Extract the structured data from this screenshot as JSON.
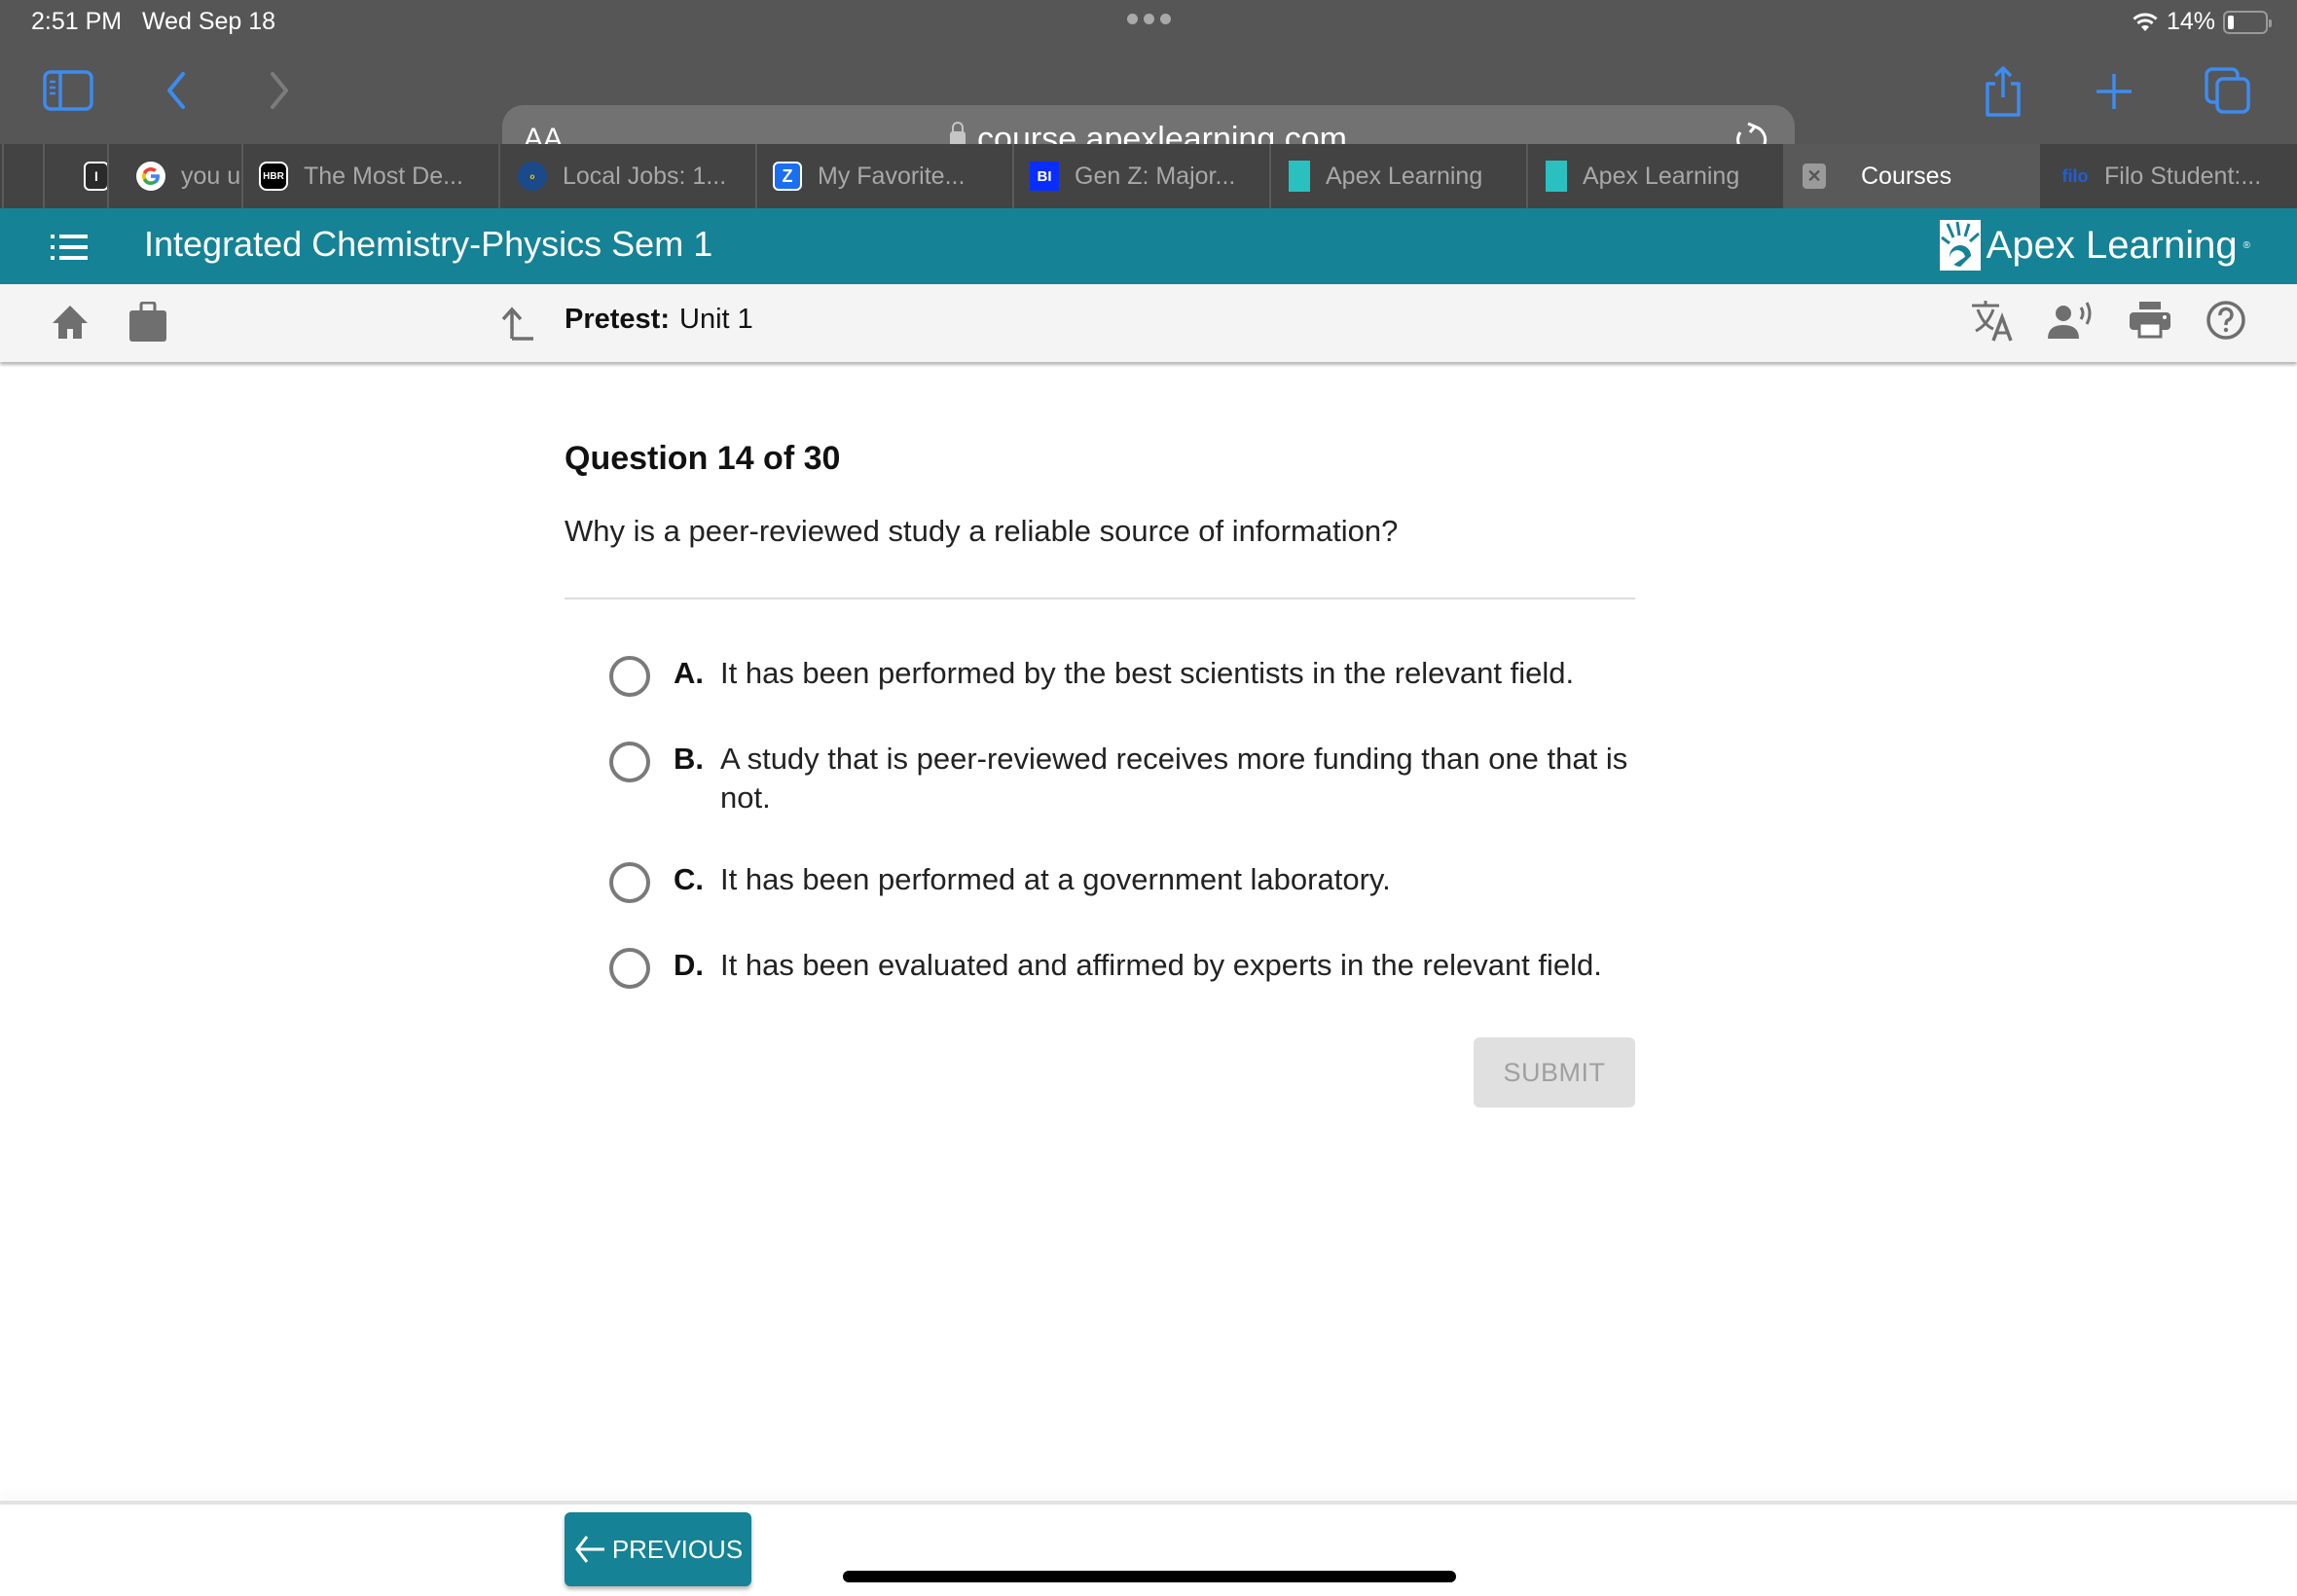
{
  "status_bar": {
    "time": "2:51 PM",
    "date": "Wed Sep 18",
    "battery_percent": "14%",
    "battery_level": 0.14
  },
  "browser": {
    "address_aa": "AA",
    "url": "course.apexlearning.com",
    "tabs": [
      {
        "title": "",
        "favicon": "I"
      },
      {
        "title": "you u",
        "favicon": "google-icon"
      },
      {
        "title": "The Most De...",
        "favicon": "HBR"
      },
      {
        "title": "Local Jobs: 1...",
        "favicon": "onet-icon"
      },
      {
        "title": "My Favorite...",
        "favicon": "zillow-icon"
      },
      {
        "title": "Gen Z: Major...",
        "favicon": "BI"
      },
      {
        "title": "Apex Learning",
        "favicon": "apex-icon"
      },
      {
        "title": "Apex Learning",
        "favicon": "apex-icon"
      },
      {
        "title": "Courses",
        "favicon": "close-icon",
        "active": true
      },
      {
        "title": "Filo Student:...",
        "favicon": "filo"
      }
    ]
  },
  "apex": {
    "course_title": "Integrated Chemistry-Physics Sem 1",
    "logo_text": "Apex Learning",
    "logo_reg": "®",
    "breadcrumb_label": "Pretest:",
    "breadcrumb_value": "Unit 1"
  },
  "question": {
    "number_label": "Question 14 of 30",
    "prompt": "Why is a peer-reviewed study a reliable source of information?",
    "options": [
      {
        "letter": "A.",
        "text": "It has been performed by the best scientists in the relevant field.",
        "selected": false
      },
      {
        "letter": "B.",
        "text": "A study that is peer-reviewed receives more funding than one that is not.",
        "selected": false
      },
      {
        "letter": "C.",
        "text": "It has been performed at a government laboratory.",
        "selected": false
      },
      {
        "letter": "D.",
        "text": "It has been evaluated and affirmed by experts in the relevant field.",
        "selected": false
      }
    ],
    "submit_label": "SUBMIT"
  },
  "footer": {
    "previous_label": "PREVIOUS"
  },
  "colors": {
    "brand_teal": "#158296",
    "safari_accent": "#3d8cf0"
  }
}
